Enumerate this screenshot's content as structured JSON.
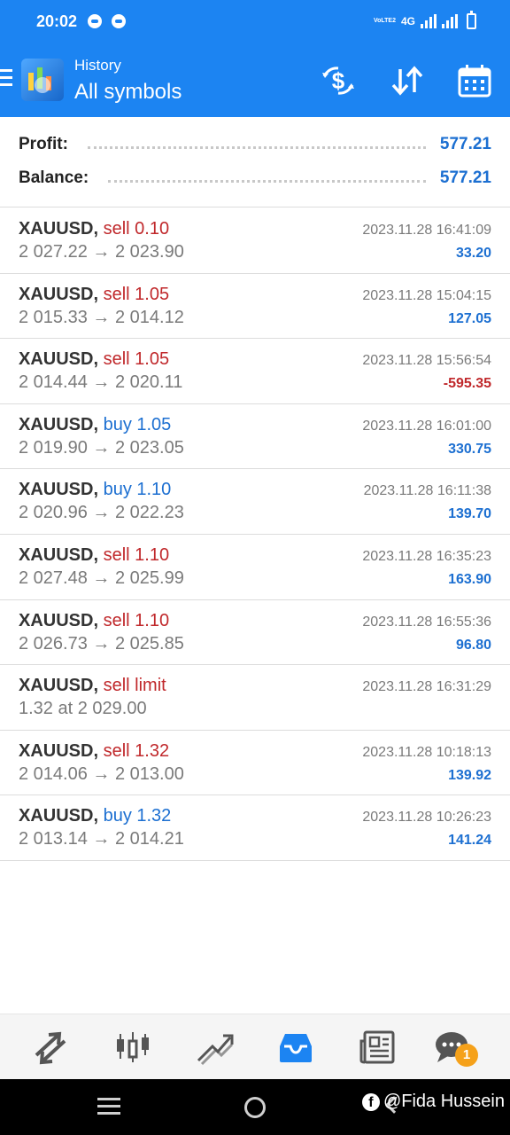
{
  "status_bar": {
    "time": "20:02",
    "volte": "VoLTE2",
    "network": "4G"
  },
  "header": {
    "subtitle": "History",
    "title": "All symbols"
  },
  "summary": {
    "profit_label": "Profit:",
    "profit_value": "577.21",
    "balance_label": "Balance:",
    "balance_value": "577.21"
  },
  "trades": [
    {
      "symbol": "XAUUSD,",
      "deal": "sell 0.10",
      "side": "sell",
      "prices": "2 027.22 → 2 023.90",
      "time": "2023.11.28 16:41:09",
      "profit": "33.20",
      "sign": "pos"
    },
    {
      "symbol": "XAUUSD,",
      "deal": "sell 1.05",
      "side": "sell",
      "prices": "2 015.33 → 2 014.12",
      "time": "2023.11.28 15:04:15",
      "profit": "127.05",
      "sign": "pos"
    },
    {
      "symbol": "XAUUSD,",
      "deal": "sell 1.05",
      "side": "sell",
      "prices": "2 014.44 → 2 020.11",
      "time": "2023.11.28 15:56:54",
      "profit": "-595.35",
      "sign": "neg"
    },
    {
      "symbol": "XAUUSD,",
      "deal": "buy 1.05",
      "side": "buy",
      "prices": "2 019.90 → 2 023.05",
      "time": "2023.11.28 16:01:00",
      "profit": "330.75",
      "sign": "pos"
    },
    {
      "symbol": "XAUUSD,",
      "deal": "buy 1.10",
      "side": "buy",
      "prices": "2 020.96 → 2 022.23",
      "time": "2023.11.28 16:11:38",
      "profit": "139.70",
      "sign": "pos"
    },
    {
      "symbol": "XAUUSD,",
      "deal": "sell 1.10",
      "side": "sell",
      "prices": "2 027.48 → 2 025.99",
      "time": "2023.11.28 16:35:23",
      "profit": "163.90",
      "sign": "pos"
    },
    {
      "symbol": "XAUUSD,",
      "deal": "sell 1.10",
      "side": "sell",
      "prices": "2 026.73 → 2 025.85",
      "time": "2023.11.28 16:55:36",
      "profit": "96.80",
      "sign": "pos"
    },
    {
      "symbol": "XAUUSD,",
      "deal": "sell limit",
      "side": "sell",
      "prices": "1.32 at 2 029.00",
      "time": "2023.11.28 16:31:29",
      "profit": "",
      "sign": "pos"
    },
    {
      "symbol": "XAUUSD,",
      "deal": "sell 1.32",
      "side": "sell",
      "prices": "2 014.06 → 2 013.00",
      "time": "2023.11.28 10:18:13",
      "profit": "139.92",
      "sign": "pos"
    },
    {
      "symbol": "XAUUSD,",
      "deal": "buy 1.32",
      "side": "buy",
      "prices": "2 013.14 → 2 014.21",
      "time": "2023.11.28 10:26:23",
      "profit": "141.24",
      "sign": "pos"
    }
  ],
  "bottom_nav": {
    "items": [
      "quotes-icon",
      "chart-icon",
      "trade-icon",
      "history-icon",
      "news-icon",
      "chat-icon"
    ],
    "active": "history-icon",
    "chat_badge": "1"
  },
  "watermark": {
    "text": "@Fida Hussein",
    "icon": "facebook-icon"
  },
  "colors": {
    "accent": "#1c84f2",
    "buy": "#1c6fd1",
    "sell": "#c0282b",
    "badge": "#f5a11a"
  }
}
